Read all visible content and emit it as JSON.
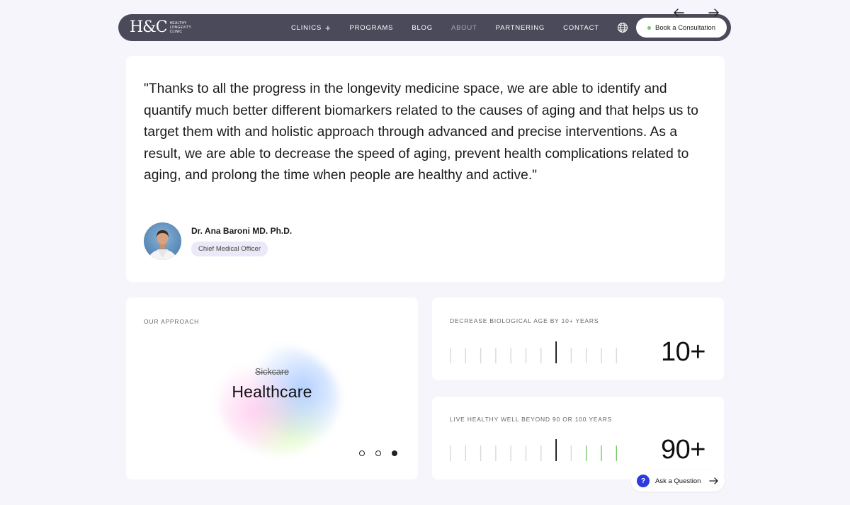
{
  "nav": {
    "logo": {
      "mark": "H&C",
      "line1": "HEALTHY",
      "line2": "LONGEVITY",
      "line3": "CLINIC"
    },
    "items": [
      {
        "label": "CLINICS",
        "has_plus": true
      },
      {
        "label": "PROGRAMS"
      },
      {
        "label": "BLOG"
      },
      {
        "label": "ABOUT",
        "muted": true
      },
      {
        "label": "PARTNERING"
      },
      {
        "label": "CONTACT"
      }
    ],
    "globe_icon": "globe-icon",
    "cta_label": "Book a Consultation"
  },
  "carousel": {
    "prev_icon": "arrow-left-icon",
    "next_icon": "arrow-right-icon"
  },
  "testimonial": {
    "quote": "\"Thanks to all the progress in the longevity medicine space, we are able to identify and quantify much better different biomarkers related to the causes of aging and that helps us to target them with and holistic approach through advanced and precise interventions. As a result, we are able to decrease the speed of aging, prevent health complications related to aging, and prolong the time when people are healthy and active.\"",
    "author_name": "Dr. Ana Baroni MD. Ph.D.",
    "author_role": "Chief Medical Officer"
  },
  "approach": {
    "label": "OUR APPROACH",
    "struck_word": "Sickcare",
    "headline": "Healthcare",
    "pagination": {
      "total": 3,
      "active_index": 2
    }
  },
  "stats": [
    {
      "label": "DECREASE BIOLOGICAL AGE BY 10+ YEARS",
      "value": "10+",
      "green_ticks": [
        7
      ],
      "marker_tick": 8,
      "tick_count": 12
    },
    {
      "label": "LIVE HEALTHY WELL BEYOND 90 OR 100 YEARS",
      "value": "90+",
      "green_ticks": [
        9,
        10,
        11
      ],
      "marker_tick": 8,
      "tick_count": 12
    }
  ],
  "colors": {
    "nav_bg": "#4a4a5a",
    "accent_green": "#7cc66d",
    "question_blue": "#2b3be0",
    "page_bg": "#f5f5fb"
  },
  "ask": {
    "label": "Ask a Question",
    "icon_glyph": "?"
  }
}
